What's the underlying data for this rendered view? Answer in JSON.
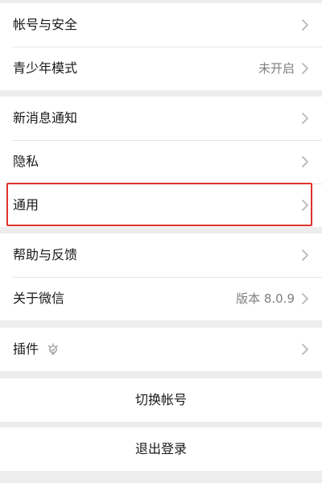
{
  "settings": {
    "groups": [
      {
        "items": [
          {
            "label": "帐号与安全",
            "value": ""
          },
          {
            "label": "青少年模式",
            "value": "未开启"
          }
        ]
      },
      {
        "items": [
          {
            "label": "新消息通知",
            "value": ""
          },
          {
            "label": "隐私",
            "value": ""
          },
          {
            "label": "通用",
            "value": ""
          }
        ]
      },
      {
        "items": [
          {
            "label": "帮助与反馈",
            "value": ""
          },
          {
            "label": "关于微信",
            "value": "版本 8.0.9"
          }
        ]
      },
      {
        "items": [
          {
            "label": "插件",
            "value": ""
          }
        ]
      }
    ],
    "switch_account": "切换帐号",
    "logout": "退出登录"
  },
  "colors": {
    "highlight": "#e0322a",
    "background": "#ededed"
  },
  "icons": {
    "chevron": "chevron-right-icon",
    "plugin": "lightbulb-icon"
  }
}
